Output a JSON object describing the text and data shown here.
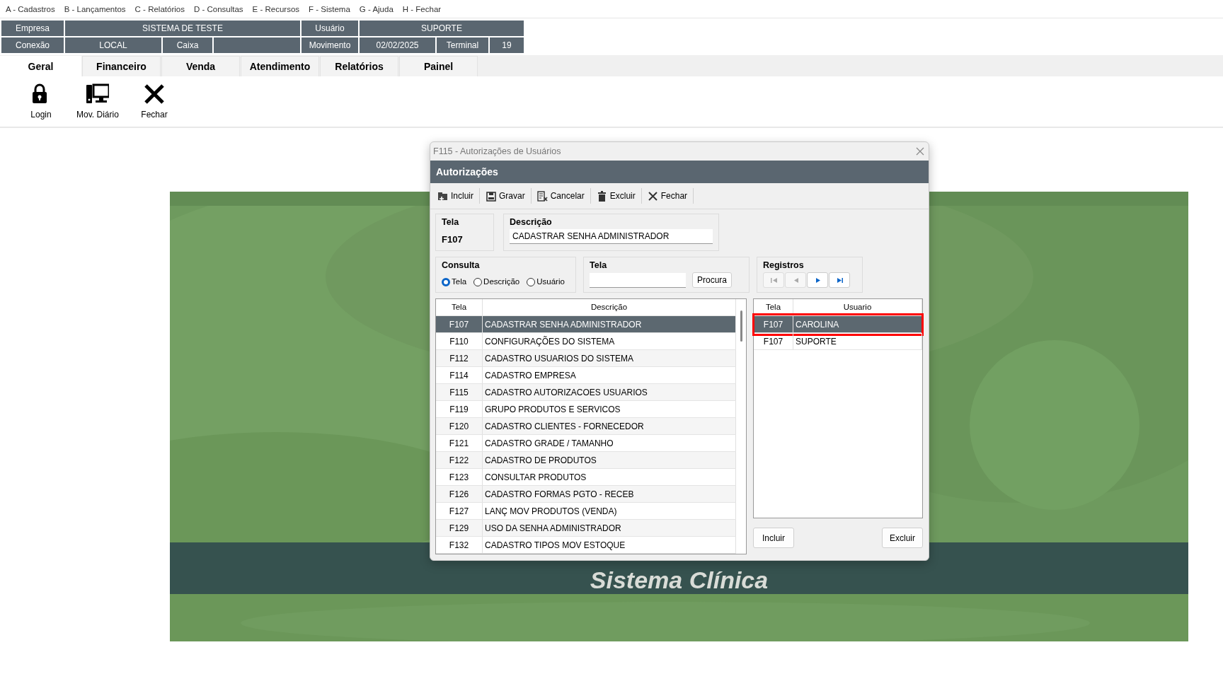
{
  "menu": [
    "A - Cadastros",
    "B - Lançamentos",
    "C - Relatórios",
    "D - Consultas",
    "E - Recursos",
    "F - Sistema",
    "G - Ajuda",
    "H - Fechar"
  ],
  "header": {
    "company": {
      "label": "Empresa",
      "value": "SISTEMA DE TESTE"
    },
    "user": {
      "label": "Usuário",
      "value": "SUPORTE"
    },
    "connection": {
      "label": "Conexão",
      "value": "LOCAL"
    },
    "cashier": {
      "label": "Caixa"
    },
    "movement": {
      "label": "Movimento",
      "value": "02/02/2025"
    },
    "terminal": {
      "label": "Terminal",
      "value": "19"
    }
  },
  "tabs": [
    {
      "label": "Geral",
      "selected": true
    },
    {
      "label": "Financeiro",
      "selected": false
    },
    {
      "label": "Venda",
      "selected": false
    },
    {
      "label": "Atendimento",
      "selected": false
    },
    {
      "label": "Relatórios",
      "selected": false
    },
    {
      "label": "Painel",
      "selected": false
    }
  ],
  "ribbon": [
    {
      "kind": "lock",
      "label": "Login"
    },
    {
      "kind": "computer",
      "label": "Mov. Diário"
    },
    {
      "kind": "close",
      "label": "Fechar"
    }
  ],
  "banner": {
    "title": "Sistema Clínica"
  },
  "dialog": {
    "title": "F115 - Autorizações de Usuários",
    "heading": "Autorizações",
    "toolbar": [
      {
        "kind": "add",
        "label": "Incluir"
      },
      {
        "kind": "save",
        "label": "Gravar"
      },
      {
        "kind": "cancel",
        "label": "Cancelar"
      },
      {
        "kind": "delete",
        "label": "Excluir"
      },
      {
        "kind": "close",
        "label": "Fechar"
      }
    ],
    "tela": {
      "label": "Tela",
      "value": "F107"
    },
    "descricao": {
      "label": "Descrição",
      "value": "CADASTRAR SENHA ADMINISTRADOR"
    },
    "consulta": {
      "label": "Consulta",
      "options": [
        {
          "label": "Tela",
          "selected": true
        },
        {
          "label": "Descrição",
          "selected": false
        },
        {
          "label": "Usuário",
          "selected": false
        }
      ]
    },
    "search": {
      "label": "Tela",
      "button": "Procura"
    },
    "registros": {
      "label": "Registros",
      "buttons": [
        {
          "kind": "first",
          "disabled": true
        },
        {
          "kind": "prev",
          "disabled": true
        },
        {
          "kind": "next",
          "disabled": false
        },
        {
          "kind": "last",
          "disabled": false
        }
      ]
    },
    "screens": {
      "columns": [
        "Tela",
        "Descrição"
      ],
      "rows": [
        {
          "cells": [
            "F107",
            "CADASTRAR SENHA ADMINISTRADOR"
          ],
          "selected": true
        },
        {
          "cells": [
            "F110",
            "CONFIGURAÇÕES DO SISTEMA"
          ],
          "selected": false
        },
        {
          "cells": [
            "F112",
            "CADASTRO USUARIOS DO SISTEMA"
          ],
          "selected": false
        },
        {
          "cells": [
            "F114",
            "CADASTRO EMPRESA"
          ],
          "selected": false
        },
        {
          "cells": [
            "F115",
            "CADASTRO AUTORIZACOES USUARIOS"
          ],
          "selected": false
        },
        {
          "cells": [
            "F119",
            "GRUPO PRODUTOS E SERVICOS"
          ],
          "selected": false
        },
        {
          "cells": [
            "F120",
            "CADASTRO CLIENTES - FORNECEDOR"
          ],
          "selected": false
        },
        {
          "cells": [
            "F121",
            "CADASTRO GRADE / TAMANHO"
          ],
          "selected": false
        },
        {
          "cells": [
            "F122",
            "CADASTRO DE PRODUTOS"
          ],
          "selected": false
        },
        {
          "cells": [
            "F123",
            "CONSULTAR PRODUTOS"
          ],
          "selected": false
        },
        {
          "cells": [
            "F126",
            "CADASTRO FORMAS PGTO - RECEB"
          ],
          "selected": false
        },
        {
          "cells": [
            "F127",
            "LANÇ MOV PRODUTOS (VENDA)"
          ],
          "selected": false
        },
        {
          "cells": [
            "F129",
            "USO DA SENHA ADMINISTRADOR"
          ],
          "selected": false
        },
        {
          "cells": [
            "F132",
            "CADASTRO TIPOS MOV ESTOQUE"
          ],
          "selected": false
        }
      ]
    },
    "users": {
      "columns": [
        "Tela",
        "Usuario"
      ],
      "rows": [
        {
          "cells": [
            "F107",
            "CAROLINA"
          ],
          "selected": true,
          "highlighted": true
        },
        {
          "cells": [
            "F107",
            "SUPORTE"
          ],
          "selected": false,
          "highlighted": false
        }
      ]
    },
    "buttons": [
      "Incluir",
      "Excluir"
    ]
  }
}
